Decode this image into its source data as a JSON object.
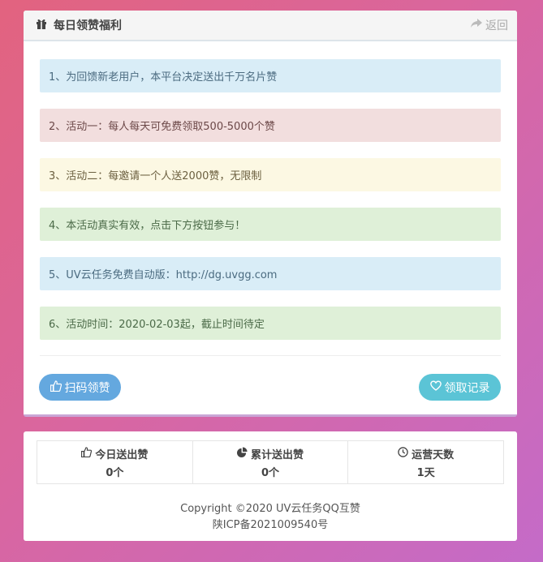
{
  "header": {
    "title": "每日领赞福利",
    "back_label": "返回"
  },
  "notices": [
    {
      "text": "1、为回馈新老用户，本平台决定送出千万名片赞",
      "style": "info"
    },
    {
      "text": "2、活动一：每人每天可免费领取500-5000个赞",
      "style": "danger"
    },
    {
      "text": "3、活动二：每邀请一个人送2000赞，无限制",
      "style": "warning"
    },
    {
      "text": "4、本活动真实有效，点击下方按钮参与！",
      "style": "success"
    },
    {
      "text": "5、UV云任务免费自动版：http://dg.uvgg.com",
      "style": "info"
    },
    {
      "text": "6、活动时间：2020-02-03起，截止时间待定",
      "style": "success"
    }
  ],
  "actions": {
    "scan_label": "扫码领赞",
    "record_label": "领取记录"
  },
  "stats": [
    {
      "label": "今日送出赞",
      "value": "0个",
      "icon": "thumbs-up-icon"
    },
    {
      "label": "累计送出赞",
      "value": "0个",
      "icon": "pie-chart-icon"
    },
    {
      "label": "运营天数",
      "value": "1天",
      "icon": "clock-icon"
    }
  ],
  "footer": {
    "copyright": "Copyright ©2020 UV云任务QQ互赞",
    "icp": "陕ICP备2021009540号"
  },
  "colors": {
    "info": "#d9edf7",
    "danger": "#f2dede",
    "warning": "#fcf8e3",
    "success": "#dff0d8",
    "scan_button": "#64a8df",
    "record_button": "#5bc4d6"
  }
}
